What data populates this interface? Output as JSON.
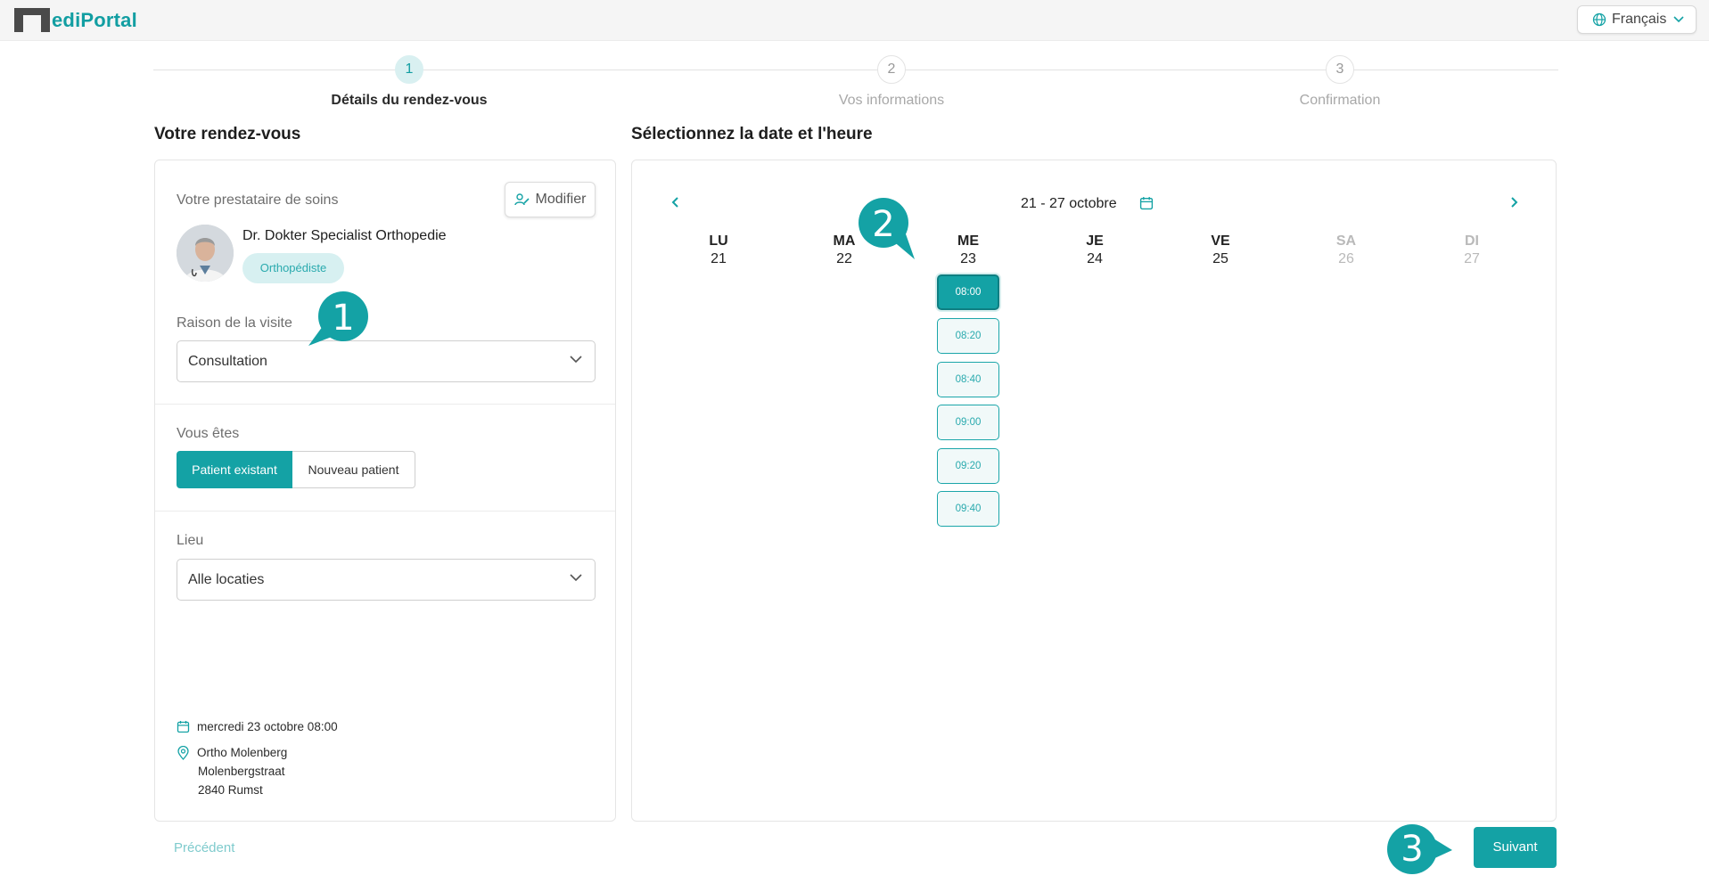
{
  "header": {
    "logo_text": "ediPortal",
    "language": "Français"
  },
  "stepper": {
    "steps": [
      {
        "number": "1",
        "label": "Détails du rendez-vous",
        "active": true
      },
      {
        "number": "2",
        "label": "Vos informations",
        "active": false
      },
      {
        "number": "3",
        "label": "Confirmation",
        "active": false
      }
    ]
  },
  "left": {
    "title": "Votre rendez-vous",
    "provider_label": "Votre prestataire de soins",
    "modify_label": "Modifier",
    "doctor_name": "Dr. Dokter Specialist Orthopedie",
    "specialty": "Orthopédiste",
    "reason_label": "Raison de la visite",
    "reason_value": "Consultation",
    "patient_type_label": "Vous êtes",
    "patient_existing": "Patient existant",
    "patient_new": "Nouveau patient",
    "location_label": "Lieu",
    "location_value": "Alle locaties",
    "summary": {
      "datetime": "mercredi 23 octobre 08:00",
      "address_name": "Ortho Molenberg",
      "address_street": "Molenbergstraat",
      "address_city": "2840 Rumst"
    }
  },
  "right": {
    "title": "Sélectionnez la date et l'heure",
    "week_range": "21 - 27 octobre",
    "days": [
      {
        "name": "LU",
        "date": "21",
        "weekend": false
      },
      {
        "name": "MA",
        "date": "22",
        "weekend": false
      },
      {
        "name": "ME",
        "date": "23",
        "weekend": false
      },
      {
        "name": "JE",
        "date": "24",
        "weekend": false
      },
      {
        "name": "VE",
        "date": "25",
        "weekend": false
      },
      {
        "name": "SA",
        "date": "26",
        "weekend": true
      },
      {
        "name": "DI",
        "date": "27",
        "weekend": true
      }
    ],
    "slots": [
      "08:00",
      "08:20",
      "08:40",
      "09:00",
      "09:20",
      "09:40"
    ],
    "selected_slot": "08:00"
  },
  "footer": {
    "prev_label": "Précédent",
    "next_label": "Suivant"
  },
  "markers": [
    "1",
    "2",
    "3"
  ],
  "colors": {
    "accent": "#14a2a5",
    "accent_light": "#d7f0f1"
  }
}
